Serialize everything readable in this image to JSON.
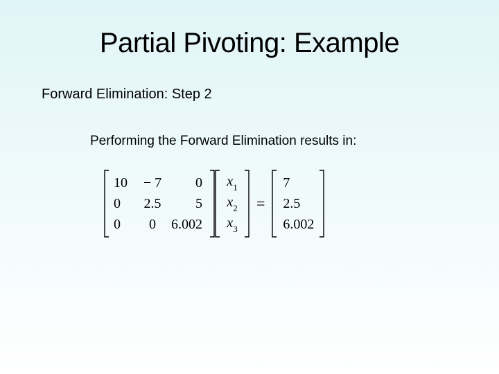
{
  "title": "Partial Pivoting: Example",
  "subheading": "Forward Elimination: Step 2",
  "body": "Performing the Forward Elimination results in:",
  "matrix": {
    "A": [
      [
        "10",
        "− 7",
        "0"
      ],
      [
        "0",
        "2.5",
        "5"
      ],
      [
        "0",
        "0",
        "6.002"
      ]
    ],
    "x": [
      {
        "var": "x",
        "sub": "1"
      },
      {
        "var": "x",
        "sub": "2"
      },
      {
        "var": "x",
        "sub": "3"
      }
    ],
    "b": [
      "7",
      "2.5",
      "6.002"
    ]
  },
  "eq_sign": "="
}
